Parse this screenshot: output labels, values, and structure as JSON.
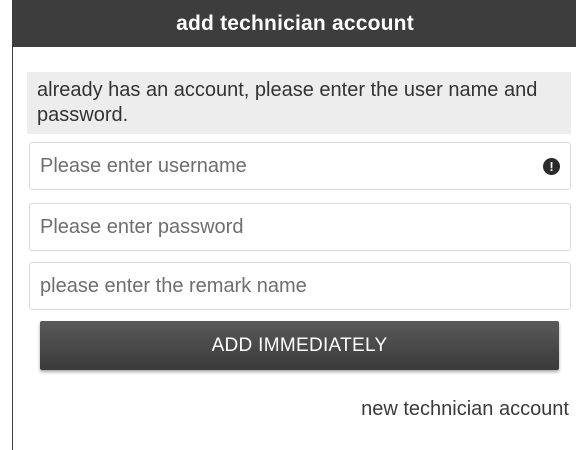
{
  "dialog": {
    "title": "add technician account",
    "info_text": "already has an account, please enter the user name and password.",
    "username": {
      "placeholder": "Please enter username",
      "value": ""
    },
    "password": {
      "placeholder": "Please enter password",
      "value": ""
    },
    "remark": {
      "placeholder": "please enter the remark name",
      "value": ""
    },
    "warning_icon": "!",
    "add_button_label": "ADD IMMEDIATELY",
    "new_account_link": "new technician account"
  },
  "colors": {
    "titlebar_bg": "#3d3d3d",
    "button_bg": "#4a4a4a",
    "info_bg": "#ededed"
  }
}
